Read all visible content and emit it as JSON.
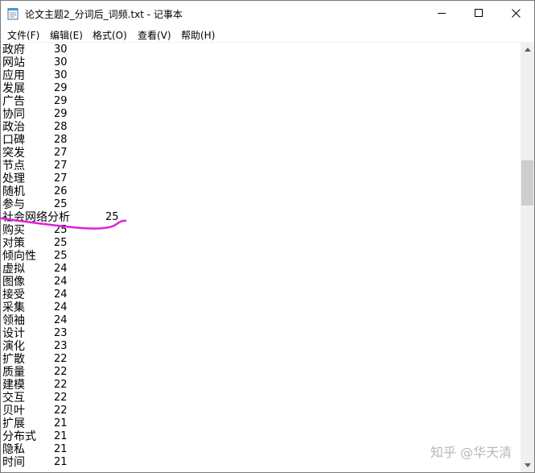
{
  "window": {
    "title": "论文主题2_分词后_词频.txt - 记事本"
  },
  "menu": [
    {
      "label": "文件(F)"
    },
    {
      "label": "编辑(E)"
    },
    {
      "label": "格式(O)"
    },
    {
      "label": "查看(V)"
    },
    {
      "label": "帮助(H)"
    }
  ],
  "lines": [
    {
      "word": "政府",
      "count": "30"
    },
    {
      "word": "网站",
      "count": "30"
    },
    {
      "word": "应用",
      "count": "30"
    },
    {
      "word": "发展",
      "count": "29"
    },
    {
      "word": "广告",
      "count": "29"
    },
    {
      "word": "协同",
      "count": "29"
    },
    {
      "word": "政治",
      "count": "28"
    },
    {
      "word": "口碑",
      "count": "28"
    },
    {
      "word": "突发",
      "count": "27"
    },
    {
      "word": "节点",
      "count": "27"
    },
    {
      "word": "处理",
      "count": "27"
    },
    {
      "word": "随机",
      "count": "26"
    },
    {
      "word": "参与",
      "count": "25"
    },
    {
      "word": "社会网络分析",
      "count": "25"
    },
    {
      "word": "购买",
      "count": "25"
    },
    {
      "word": "对策",
      "count": "25"
    },
    {
      "word": "倾向性",
      "count": "25"
    },
    {
      "word": "虚拟",
      "count": "24"
    },
    {
      "word": "图像",
      "count": "24"
    },
    {
      "word": "接受",
      "count": "24"
    },
    {
      "word": "采集",
      "count": "24"
    },
    {
      "word": "领袖",
      "count": "24"
    },
    {
      "word": "设计",
      "count": "23"
    },
    {
      "word": "演化",
      "count": "23"
    },
    {
      "word": "扩散",
      "count": "22"
    },
    {
      "word": "质量",
      "count": "22"
    },
    {
      "word": "建模",
      "count": "22"
    },
    {
      "word": "交互",
      "count": "22"
    },
    {
      "word": "贝叶",
      "count": "22"
    },
    {
      "word": "扩展",
      "count": "21"
    },
    {
      "word": "分布式",
      "count": "21"
    },
    {
      "word": "隐私",
      "count": "21"
    },
    {
      "word": "时间",
      "count": "21"
    }
  ],
  "watermark": "知乎 @华天清",
  "colors": {
    "annotation": "#e020d8"
  },
  "icons": [
    "notepad-icon",
    "minimize-icon",
    "maximize-icon",
    "close-icon",
    "scroll-up-icon",
    "scroll-down-icon"
  ]
}
